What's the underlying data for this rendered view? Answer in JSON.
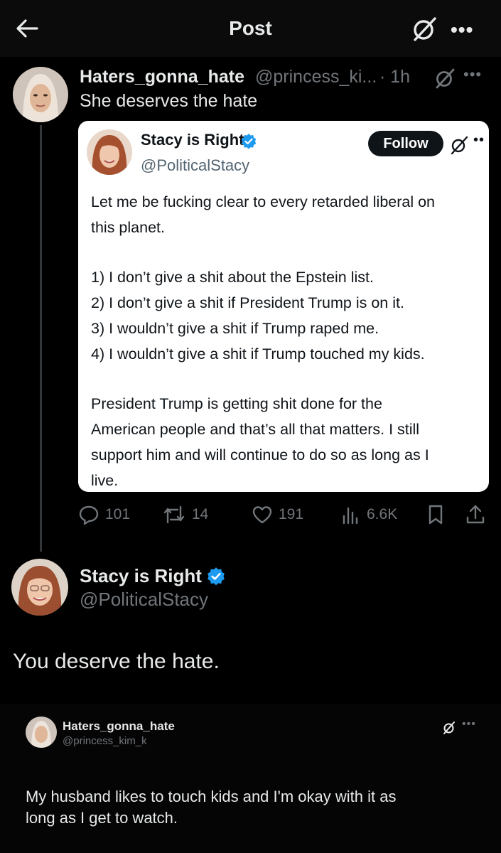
{
  "header": {
    "title": "Post"
  },
  "reply": {
    "display_name": "Haters_gonna_hate",
    "handle": "@princess_ki...",
    "time": "· 1h",
    "text": "She deserves the hate",
    "quoted_screenshot": {
      "display_name": "Stacy is Right",
      "handle": "@PoliticalStacy",
      "follow_label": "Follow",
      "lines": [
        "Let me be fucking clear to every retarded liberal on",
        "this planet.",
        "1) I don’t give a shit about the Epstein list.",
        "2) I don’t give a shit if President Trump is on it.",
        "3) I wouldn’t give a shit if Trump raped me.",
        "4) I wouldn’t give a shit if Trump touched my kids.",
        "President Trump is getting shit done for the",
        "American people and that’s all that matters. I still",
        "support him and will continue to do so as long as I",
        "live."
      ]
    },
    "actions": {
      "replies": "101",
      "reposts": "14",
      "likes": "191",
      "views": "6.6K"
    }
  },
  "main_post": {
    "display_name": "Stacy is Right",
    "handle": "@PoliticalStacy",
    "text": "You deserve the hate.",
    "attached_screenshot": {
      "display_name": "Haters_gonna_hate",
      "handle": "@princess_kim_k",
      "lines": [
        "My husband likes to touch kids and I'm okay with it as",
        "long as I get to watch."
      ]
    }
  },
  "colors": {
    "background": "#000000",
    "text_primary": "#e7e9ea",
    "text_secondary": "#71767b",
    "verified_blue": "#1d9bf0"
  },
  "icons": [
    "back-arrow-icon",
    "grok-icon",
    "more-icon",
    "verified-badge-icon",
    "reply-icon",
    "repost-icon",
    "like-icon",
    "views-icon",
    "bookmark-icon",
    "share-icon"
  ]
}
